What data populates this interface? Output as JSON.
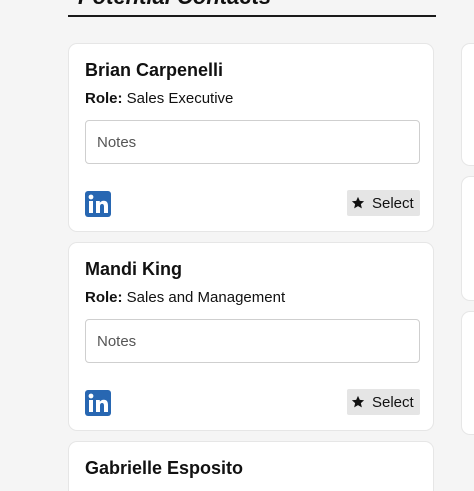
{
  "section": {
    "title": "Potential Contacts"
  },
  "contacts": [
    {
      "name": "Brian Carpenelli",
      "role_label": "Role:",
      "role": "Sales Executive",
      "notes_placeholder": "Notes",
      "select_label": "Select",
      "linkedin_icon": "linkedin-icon",
      "select_icon": "star-icon"
    },
    {
      "name": "Mandi King",
      "role_label": "Role:",
      "role": "Sales and Management",
      "notes_placeholder": "Notes",
      "select_label": "Select",
      "linkedin_icon": "linkedin-icon",
      "select_icon": "star-icon"
    },
    {
      "name": "Gabrielle Esposito"
    }
  ],
  "colors": {
    "linkedin": "#2867b2",
    "background": "#f5f5f5",
    "card": "#ffffff",
    "select_button": "#e5e5e5"
  }
}
